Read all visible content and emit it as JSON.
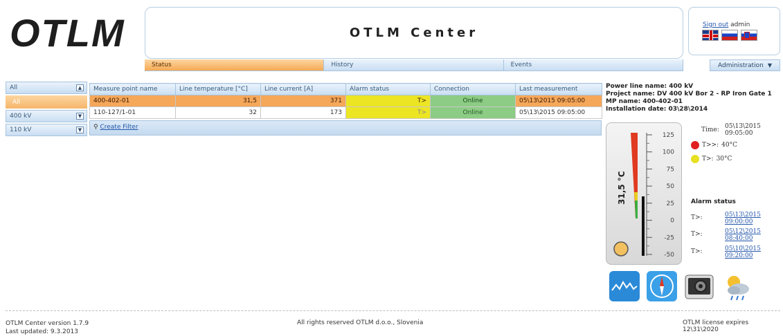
{
  "header": {
    "logo_text": "OTLM",
    "title": "OTLM Center",
    "sign_out_label": "Sign out",
    "username": "admin"
  },
  "tabs": [
    {
      "label": "Status",
      "active": true
    },
    {
      "label": "History",
      "active": false
    },
    {
      "label": "Events",
      "active": false
    }
  ],
  "admin_menu": {
    "label": "Administration",
    "icon": "chevron-down-icon"
  },
  "filter_panel": {
    "groups": [
      {
        "label": "All",
        "expanded": true,
        "items": [
          "All"
        ]
      },
      {
        "label": "400 kV",
        "expanded": false,
        "items": []
      },
      {
        "label": "110 kV",
        "expanded": false,
        "items": []
      }
    ]
  },
  "table": {
    "columns": [
      "Measure point name",
      "Line temperature [°C]",
      "Line current [A]",
      "Alarm status",
      "Connection",
      "Last measurement"
    ],
    "rows": [
      {
        "name": "400-402-01",
        "temp": "31,5",
        "current": "371",
        "alarm": "T>",
        "connection": "Online",
        "last": "05\\13\\2015 09:05:00",
        "selected": true
      },
      {
        "name": "110-127/1-01",
        "temp": "32",
        "current": "173",
        "alarm": "T>",
        "connection": "Online",
        "last": "05\\13\\2015 09:05:00",
        "selected": false
      }
    ],
    "create_filter_label": "Create Filter"
  },
  "details": {
    "power_line": "Power line name: 400 kV",
    "project": "Project name: DV 400 kV Bor 2 - RP Iron Gate 1",
    "mp": "MP name: 400-402-01",
    "install": "Installation date: 03\\28\\2014"
  },
  "thermometer": {
    "reading": "31,5 °C",
    "value": 31.5,
    "scale": [
      "125",
      "100",
      "75",
      "50",
      "25",
      "0",
      "-25",
      "-50"
    ],
    "scale_min": -50,
    "scale_max": 125
  },
  "time_info": {
    "label": "Time:",
    "date": "05\\13\\2015",
    "time": "09:05:00"
  },
  "thresholds": [
    {
      "label": "T>>:",
      "value": "40°C",
      "color": "#e02020"
    },
    {
      "label": "T>:",
      "value": "30°C",
      "color": "#e8e020"
    }
  ],
  "alarm_status": {
    "title": "Alarm status",
    "entries": [
      {
        "label": "T>:",
        "date": "05\\13\\2015",
        "time": "09:00:00"
      },
      {
        "label": "T>:",
        "date": "05\\12\\2015",
        "time": "08:40:00"
      },
      {
        "label": "T>:",
        "date": "05\\10\\2015",
        "time": "09:20:00"
      }
    ]
  },
  "tool_icons": [
    "chart-icon",
    "compass-icon",
    "camera-icon",
    "weather-icon"
  ],
  "footer": {
    "version": "OTLM Center version 1.7.9",
    "updated": "Last updated: 9.3.2013",
    "rights": "All rights reserved OTLM d.o.o., Slovenia",
    "license": "OTLM license expires 12\\31\\2020"
  }
}
